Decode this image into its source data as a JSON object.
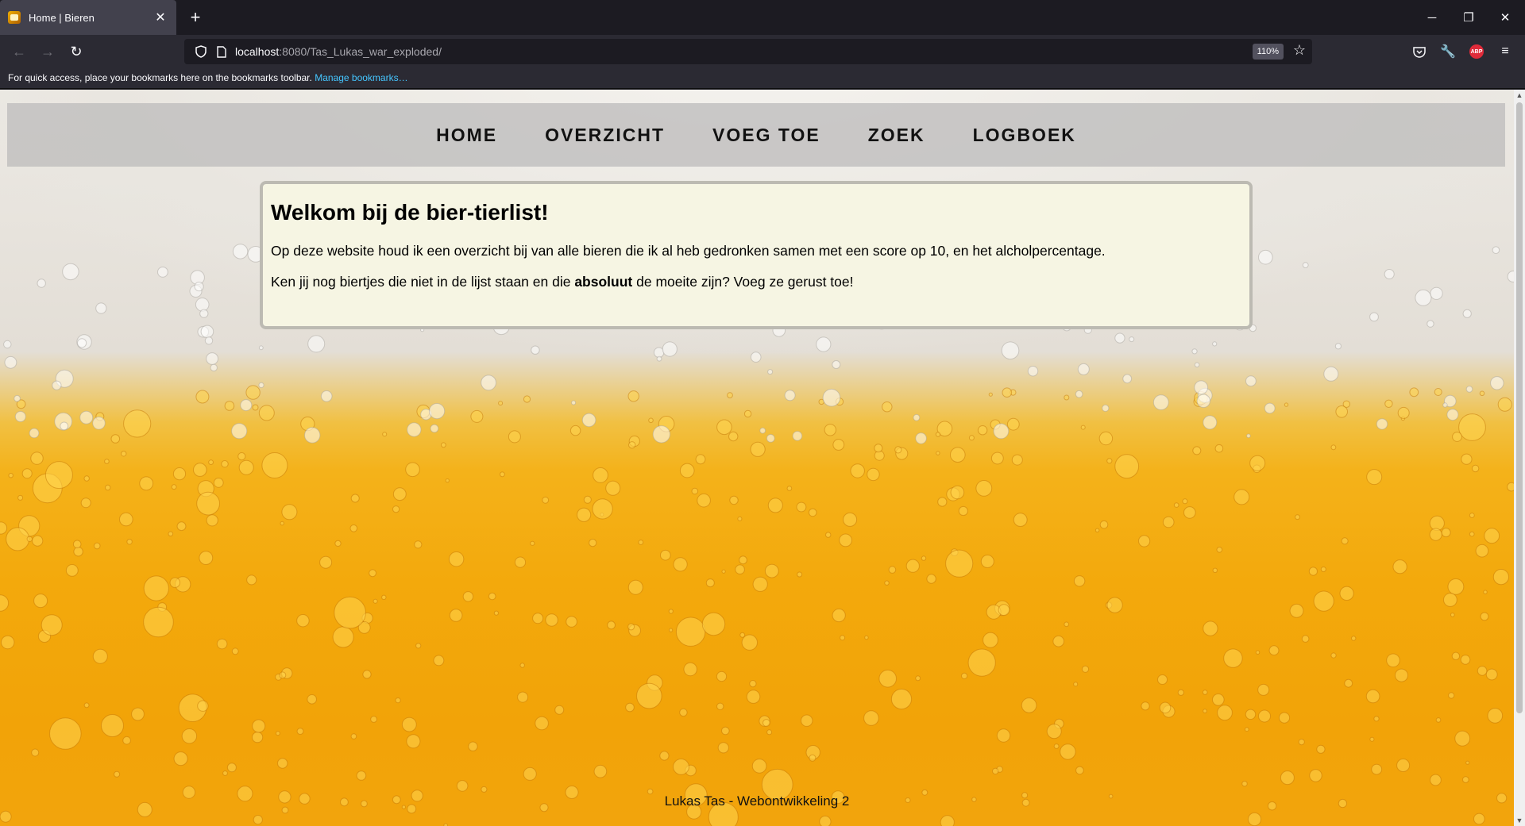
{
  "browser": {
    "tab_title": "Home | Bieren",
    "url_host": "localhost",
    "url_rest": ":8080/Tas_Lukas_war_exploded/",
    "zoom": "110%",
    "bookmarks_text": "For quick access, place your bookmarks here on the bookmarks toolbar.",
    "bookmarks_link": "Manage bookmarks…",
    "abp_label": "ABP"
  },
  "site": {
    "nav": [
      "HOME",
      "OVERZICHT",
      "VOEG TOE",
      "ZOEK",
      "LOGBOEK"
    ],
    "welcome": {
      "title": "Welkom bij de bier-tierlist!",
      "paragraph1": "Op deze website houd ik een overzicht bij van alle bieren die ik al heb gedronken samen met een score op 10, en het alcholpercentage.",
      "paragraph2_before": "Ken jij nog biertjes die niet in de lijst staan en die ",
      "paragraph2_bold": "absoluut",
      "paragraph2_after": " de moeite zijn? Voeg ze gerust toe!"
    },
    "footer": "Lukas Tas - Webontwikkeling 2"
  },
  "colors": {
    "chrome_dark": "#1c1b22",
    "chrome_mid": "#2b2a33",
    "tab_active": "#42414d",
    "link_blue": "#45c6ff",
    "welcome_bg": "#f6f5e3",
    "beer_amber": "#f2a308"
  }
}
